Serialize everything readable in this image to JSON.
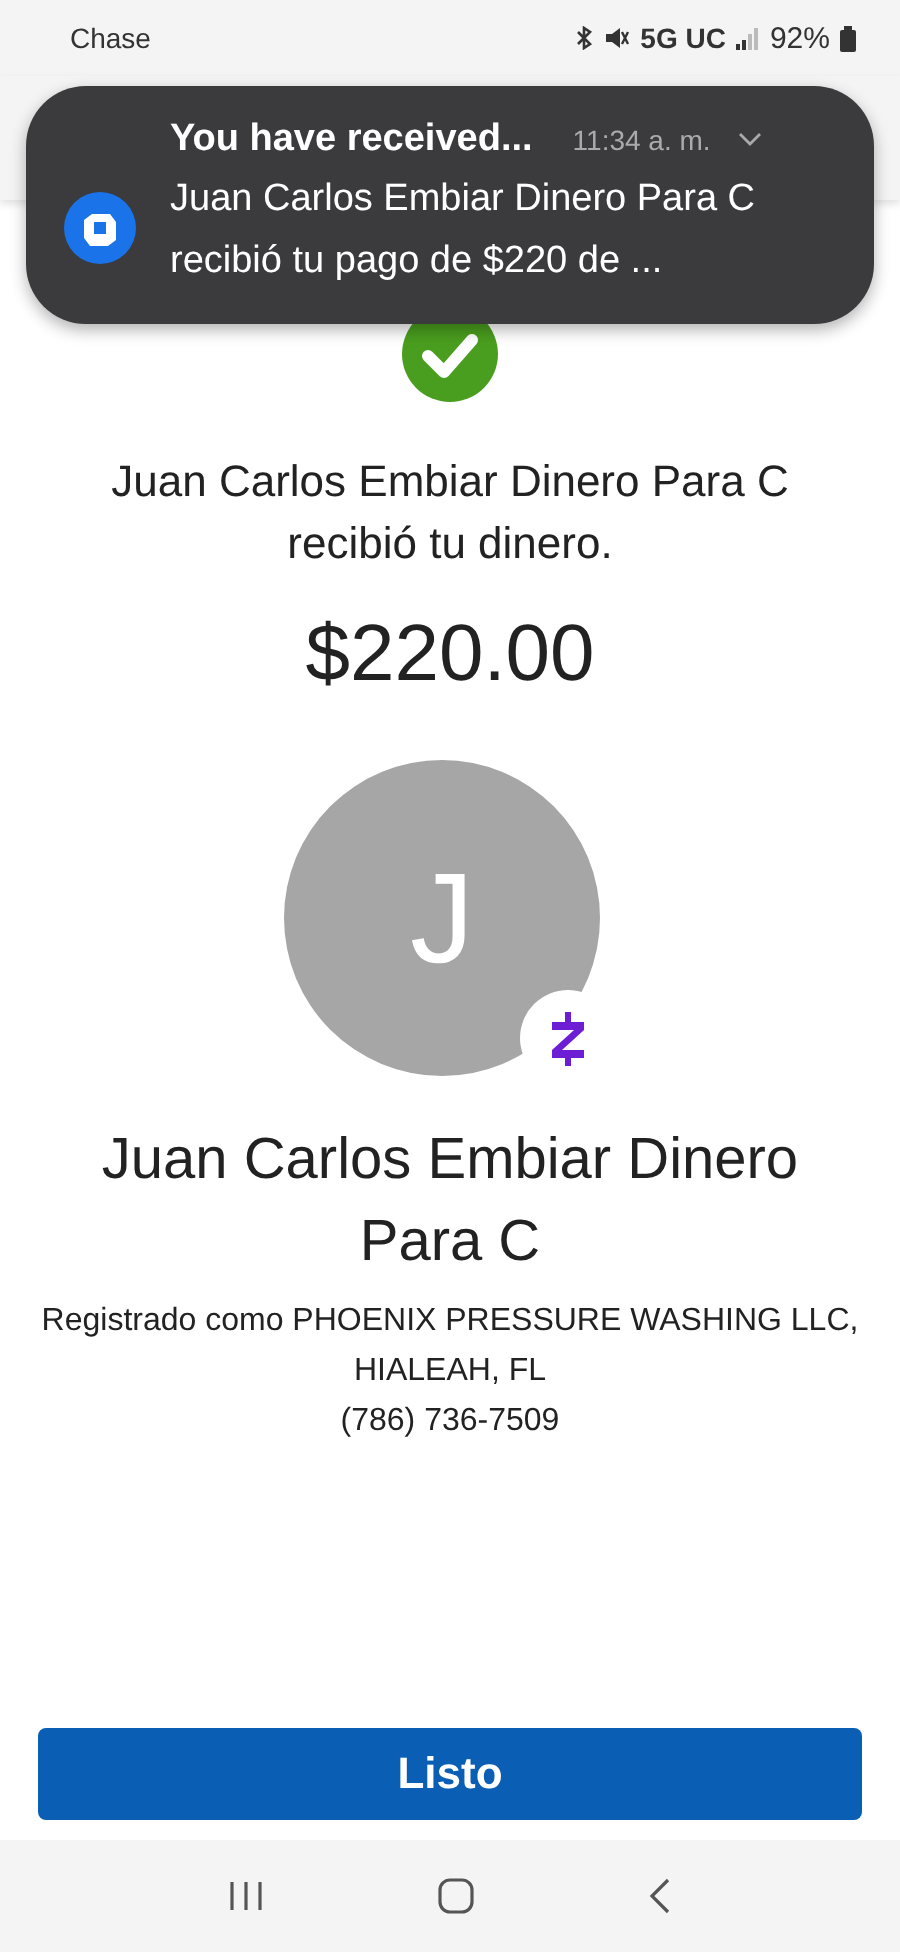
{
  "status_bar": {
    "app": "Chase",
    "network": "5G UC",
    "battery": "92%"
  },
  "notification": {
    "title": "You have received...",
    "time": "11:34 a. m.",
    "body": "Juan Carlos Embiar Dinero Para C recibió tu pago de $220 de ..."
  },
  "confirmation": {
    "message": "Juan Carlos Embiar Dinero Para C recibió tu dinero.",
    "amount": "$220.00"
  },
  "recipient": {
    "initial": "J",
    "name": "Juan Carlos Embiar Dinero Para C",
    "registered": "Registrado como PHOENIX PRESSURE WASHING LLC, HIALEAH, FL",
    "phone": "(786) 736-7509"
  },
  "button": {
    "label": "Listo"
  }
}
